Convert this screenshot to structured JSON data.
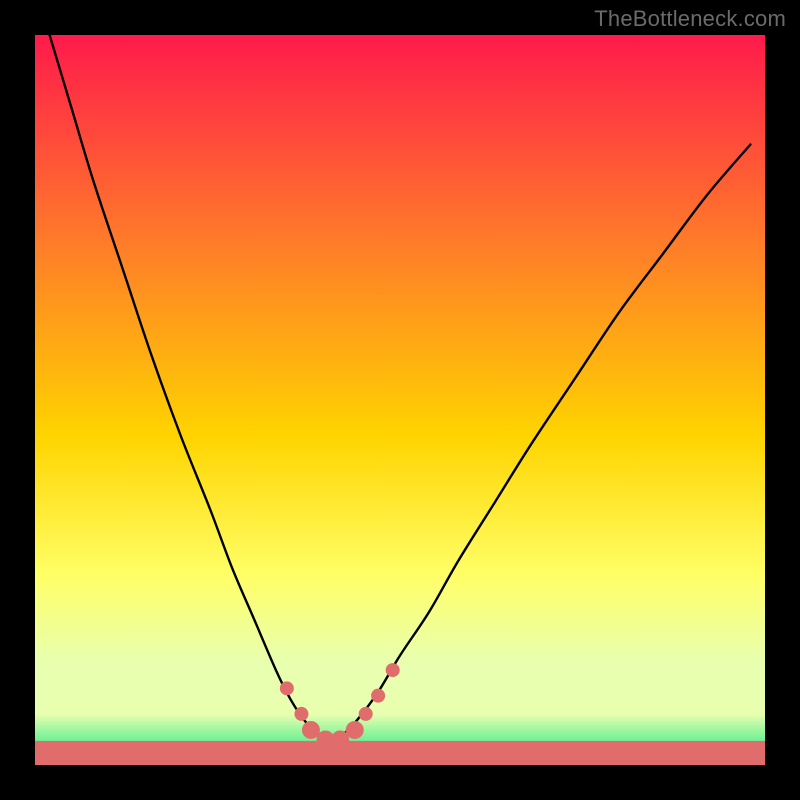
{
  "watermark": "TheBottleneck.com",
  "chart_data": {
    "type": "line",
    "title": "",
    "xlabel": "",
    "ylabel": "",
    "xlim": [
      0,
      100
    ],
    "ylim": [
      0,
      100
    ],
    "grid": false,
    "legend": false,
    "gradient_colors": {
      "top": "#ff1a4b",
      "mid_upper": "#ff7a2a",
      "mid": "#ffd400",
      "mid_lower": "#ffff66",
      "near_bottom": "#e8ffb0",
      "bottom": "#00e57a"
    },
    "series": [
      {
        "name": "bottleneck-curve",
        "stroke": "#000000",
        "x": [
          2,
          5,
          8,
          12,
          16,
          20,
          24,
          27,
          30,
          33,
          35,
          37,
          39,
          40.5,
          42,
          44,
          47,
          50,
          54,
          58,
          63,
          68,
          74,
          80,
          86,
          92,
          98
        ],
        "y": [
          100,
          90,
          80,
          68,
          56,
          45,
          35,
          27,
          20,
          13,
          9,
          6,
          4,
          3.3,
          4,
          6,
          10,
          15,
          21,
          28,
          36,
          44,
          53,
          62,
          70,
          78,
          85
        ]
      }
    ],
    "markers": {
      "name": "highlight-points",
      "fill": "#e06c6c",
      "radius_small": 7,
      "radius_large": 9,
      "points": [
        {
          "x": 34.5,
          "y": 10.5,
          "r": 7
        },
        {
          "x": 36.5,
          "y": 7.0,
          "r": 7
        },
        {
          "x": 37.8,
          "y": 4.8,
          "r": 9
        },
        {
          "x": 39.8,
          "y": 3.5,
          "r": 9
        },
        {
          "x": 41.8,
          "y": 3.5,
          "r": 9
        },
        {
          "x": 43.8,
          "y": 4.8,
          "r": 9
        },
        {
          "x": 45.3,
          "y": 7.0,
          "r": 7
        },
        {
          "x": 47.0,
          "y": 9.5,
          "r": 7
        },
        {
          "x": 49.0,
          "y": 13.0,
          "r": 7
        }
      ]
    },
    "baseline_band": {
      "y_from": 0,
      "y_to": 3.3,
      "fill": "#e06c6c"
    }
  }
}
